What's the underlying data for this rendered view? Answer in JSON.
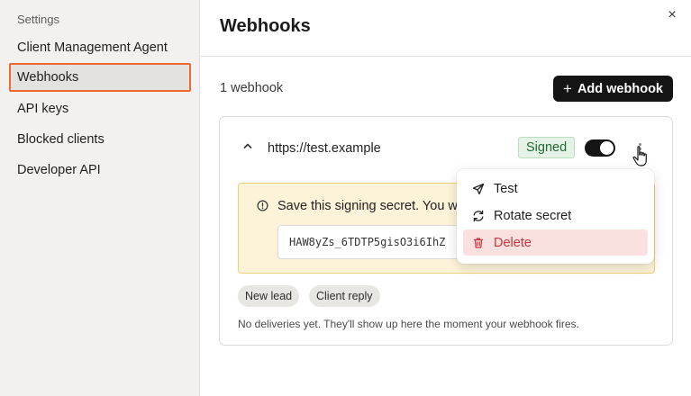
{
  "sidebar": {
    "heading": "Settings",
    "items": [
      {
        "label": "Client Management Agent",
        "active": false
      },
      {
        "label": "Webhooks",
        "active": true
      },
      {
        "label": "API keys",
        "active": false
      },
      {
        "label": "Blocked clients",
        "active": false
      },
      {
        "label": "Developer API",
        "active": false
      }
    ]
  },
  "dialog": {
    "close_label": "×"
  },
  "main": {
    "title": "Webhooks",
    "count_label": "1 webhook",
    "add_button_icon": "+",
    "add_button_label": "Add webhook"
  },
  "webhook": {
    "url": "https://test.example",
    "status_badge": "Signed",
    "enabled": true,
    "secret_message": "Save this signing secret. You w",
    "secret_value": "HAW8yZs_6TDTP5gisO3i6IhZ",
    "events": [
      "New lead",
      "Client reply"
    ],
    "empty_deliveries": "No deliveries yet. They'll show up here the moment your webhook fires."
  },
  "menu": {
    "items": [
      {
        "label": "Test",
        "icon": "send-icon"
      },
      {
        "label": "Rotate secret",
        "icon": "refresh-icon"
      },
      {
        "label": "Delete",
        "icon": "trash-icon"
      }
    ]
  },
  "colors": {
    "active_nav_border": "#ee6a30",
    "primary_button": "#141414",
    "signed_badge_bg": "#e5f3e7",
    "signed_badge_text": "#216b33",
    "warning_bg": "#fdf3d8",
    "warning_border": "#f0cf76",
    "danger_bg": "#fbe0e0",
    "danger_text": "#c7353a"
  }
}
